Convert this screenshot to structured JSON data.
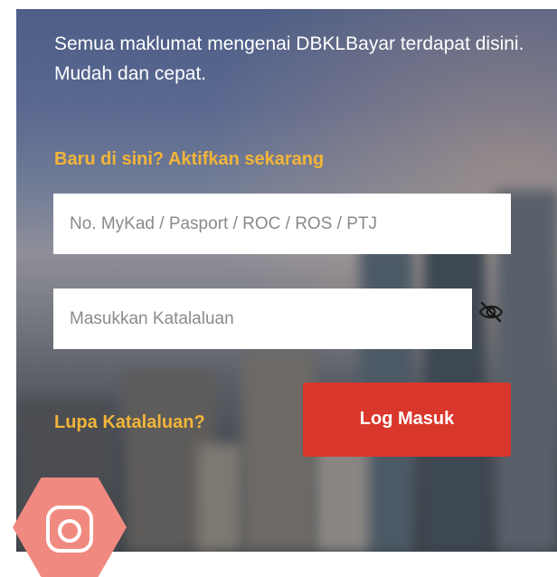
{
  "intro_text": "Semua maklumat mengenai DBKLBayar terdapat disini. Mudah dan cepat.",
  "activate_link": "Baru di sini? Aktifkan sekarang",
  "id_input": {
    "placeholder": "No. MyKad / Pasport / ROC / ROS / PTJ",
    "value": ""
  },
  "password_input": {
    "placeholder": "Masukkan Katalaluan",
    "value": ""
  },
  "toggle_icon": "eye-slash-icon",
  "forgot_link": "Lupa Katalaluan?",
  "login_button": "Log Masuk",
  "social_icon": "instagram-icon",
  "colors": {
    "accent_link": "#f2b53a",
    "login_button": "#d9362c",
    "instagram_badge": "#f08a80"
  }
}
